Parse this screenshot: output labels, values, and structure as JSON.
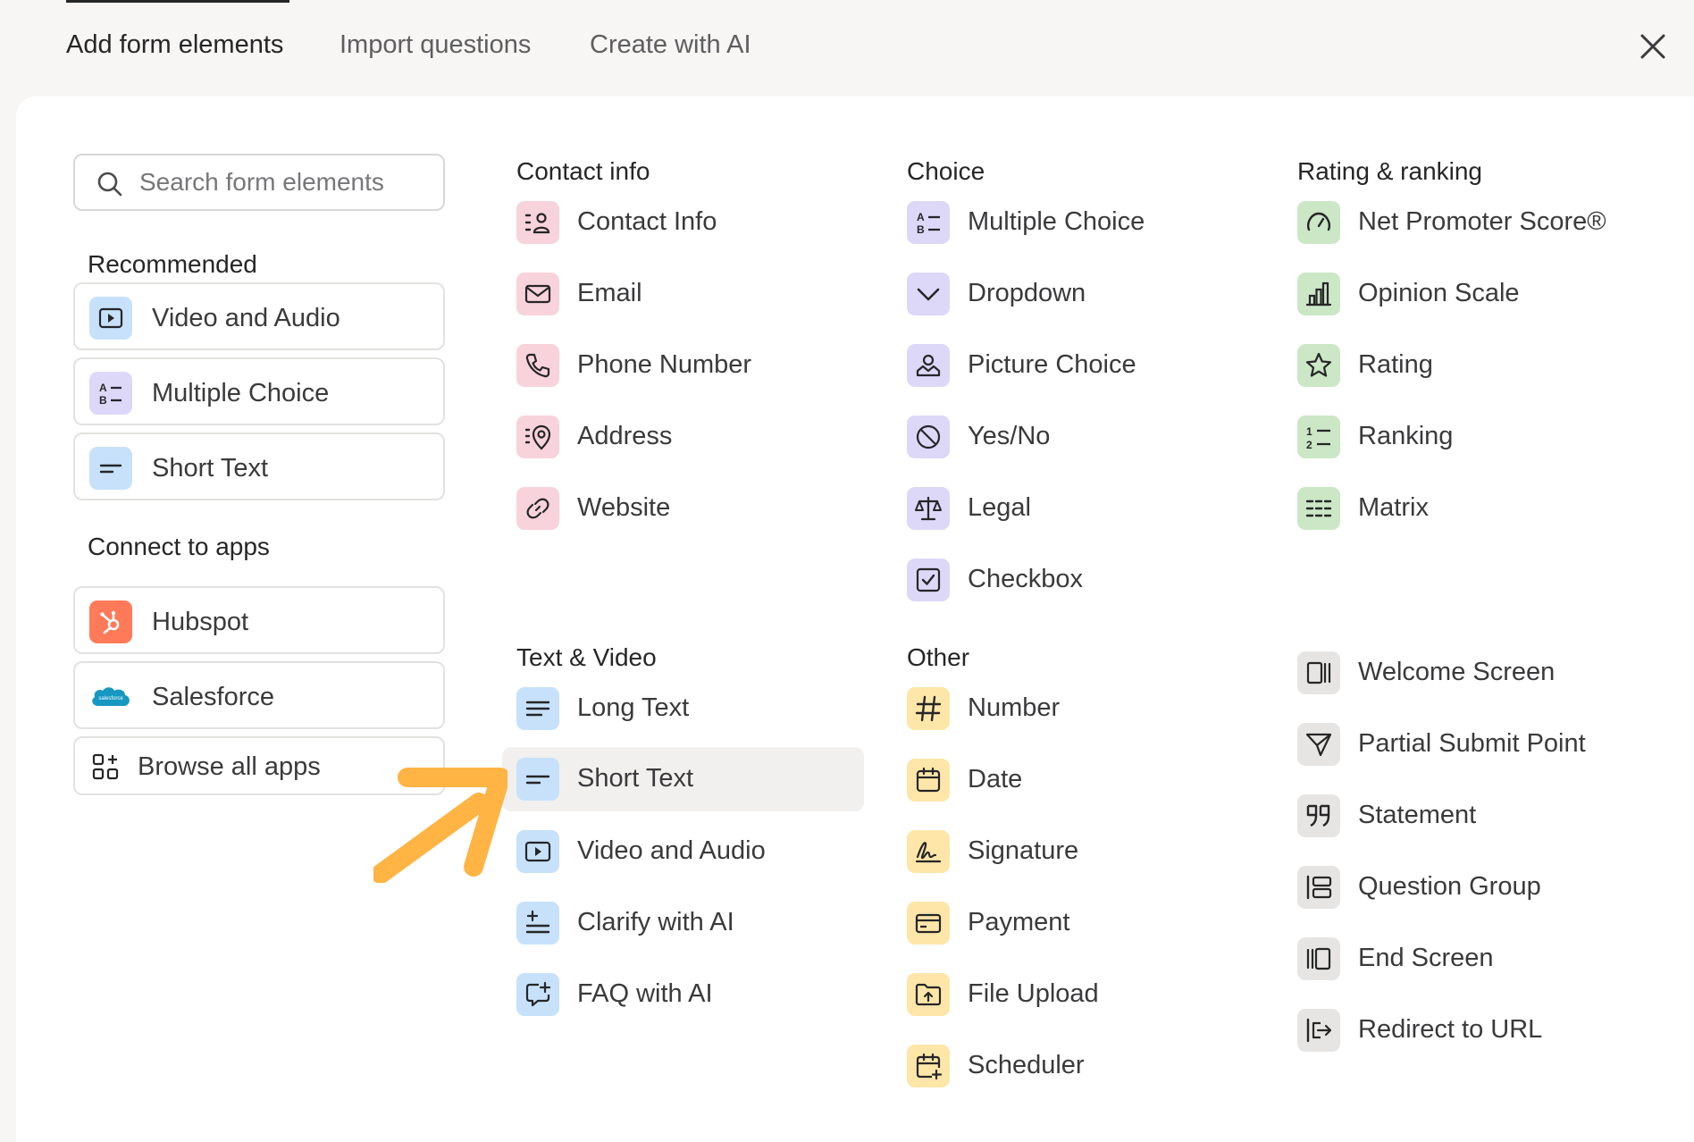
{
  "tabs": [
    "Add form elements",
    "Import questions",
    "Create with AI"
  ],
  "search": {
    "placeholder": "Search form elements"
  },
  "sidebar": {
    "recommended_title": "Recommended",
    "recommended": [
      "Video and Audio",
      "Multiple Choice",
      "Short Text"
    ],
    "connect_title": "Connect to apps",
    "apps": [
      "Hubspot",
      "Salesforce"
    ],
    "browse_label": "Browse all apps",
    "salesforce_logo_text": "salesforce"
  },
  "contact": {
    "title": "Contact info",
    "items": [
      "Contact Info",
      "Email",
      "Phone Number",
      "Address",
      "Website"
    ]
  },
  "choice": {
    "title": "Choice",
    "items": [
      "Multiple Choice",
      "Dropdown",
      "Picture Choice",
      "Yes/No",
      "Legal",
      "Checkbox"
    ]
  },
  "rating": {
    "title": "Rating & ranking",
    "items": [
      "Net Promoter Score®",
      "Opinion Scale",
      "Rating",
      "Ranking",
      "Matrix"
    ]
  },
  "textvideo": {
    "title": "Text & Video",
    "items": [
      "Long Text",
      "Short Text",
      "Video and Audio",
      "Clarify with AI",
      "FAQ with AI"
    ]
  },
  "other": {
    "title": "Other",
    "items": [
      "Number",
      "Date",
      "Signature",
      "Payment",
      "File Upload",
      "Scheduler"
    ]
  },
  "misc": {
    "items": [
      "Welcome Screen",
      "Partial Submit Point",
      "Statement",
      "Question Group",
      "End Screen",
      "Redirect to URL"
    ]
  },
  "colors": {
    "contact": "#f8d3dc",
    "choice": "#ddd7f8",
    "rating": "#cbe7c6",
    "text_video": "#c7e1fa",
    "other": "#fde6a8",
    "misc": "#e6e5e4",
    "hubspot": "#ff7a59",
    "salesforce": "#1798c1",
    "arrow": "#ffb443"
  }
}
